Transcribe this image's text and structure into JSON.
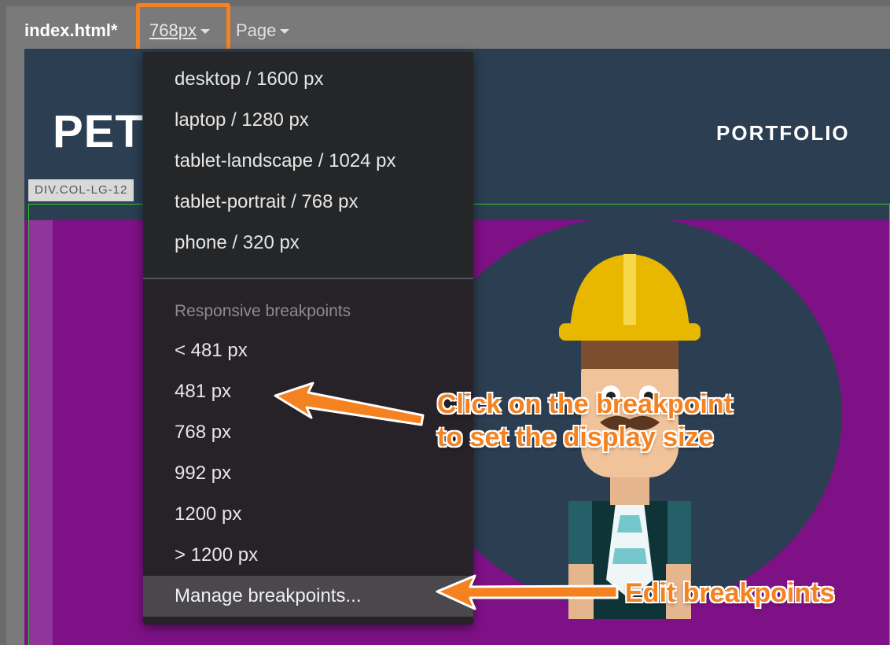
{
  "toolbar": {
    "file_name": "index.html*",
    "size_value": "768px",
    "page_label": "Page"
  },
  "website": {
    "logo_text": "PETER PINE",
    "nav_item": "PORTFOLIO",
    "element_tag": "DIV.COL-LG-12"
  },
  "dropdown": {
    "device_items": [
      "desktop / 1600 px",
      "laptop / 1280 px",
      "tablet-landscape / 1024 px",
      "tablet-portrait / 768 px",
      "phone / 320 px"
    ],
    "section_label": "Responsive breakpoints",
    "breakpoints": [
      "< 481 px",
      "481 px",
      "768 px",
      "992 px",
      "1200 px",
      "> 1200 px"
    ],
    "manage_label": "Manage breakpoints..."
  },
  "callouts": {
    "breakpoint_line1": "Click on the breakpoint",
    "breakpoint_line2": "to set the display size",
    "edit": "Edit breakpoints"
  },
  "colors": {
    "accent_orange": "#f58220",
    "header_navy": "#2c3e52",
    "page_purple": "#7f1187",
    "menu_bg": "#262228",
    "selection_green": "#31c931"
  },
  "icons": [
    "caret-down-icon",
    "caret-down-icon",
    "arrow-callout-icon",
    "arrow-callout-icon"
  ]
}
